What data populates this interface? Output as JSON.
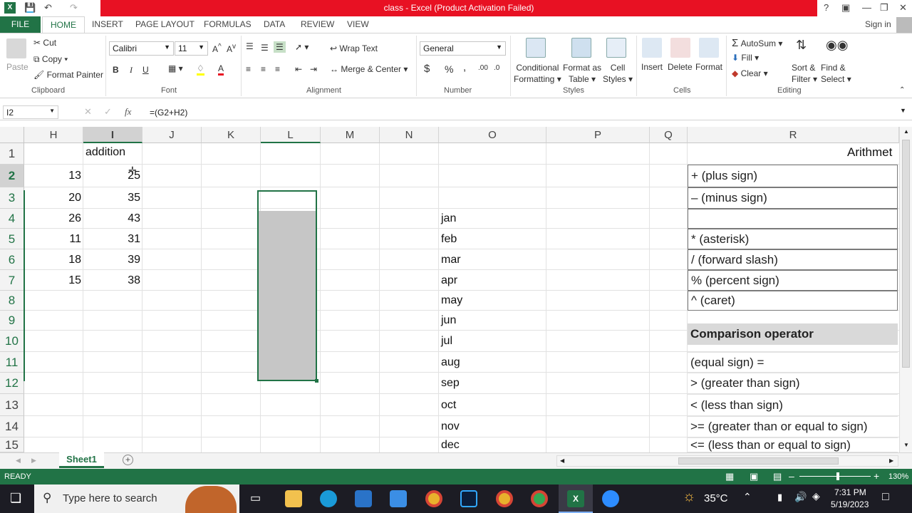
{
  "window": {
    "title": "class - Excel (Product Activation Failed)",
    "sign_in": "Sign in"
  },
  "tabs": [
    "FILE",
    "HOME",
    "INSERT",
    "PAGE LAYOUT",
    "FORMULAS",
    "DATA",
    "REVIEW",
    "VIEW"
  ],
  "ribbon": {
    "clipboard": {
      "paste": "Paste",
      "cut": "Cut",
      "copy": "Copy",
      "format_painter": "Format Painter",
      "label": "Clipboard"
    },
    "font": {
      "name": "Calibri",
      "size": "11",
      "label": "Font",
      "bold": "B",
      "italic": "I",
      "underline": "U"
    },
    "alignment": {
      "wrap": "Wrap Text",
      "merge": "Merge & Center",
      "label": "Alignment"
    },
    "number": {
      "format": "General",
      "currency": "$",
      "percent": "%",
      "comma": ",",
      "label": "Number"
    },
    "styles": {
      "conditional": "Conditional",
      "conditional2": "Formatting",
      "format_as": "Format as",
      "format_as2": "Table",
      "cell": "Cell",
      "cell2": "Styles",
      "label": "Styles"
    },
    "cells": {
      "insert": "Insert",
      "delete": "Delete",
      "format": "Format",
      "label": "Cells"
    },
    "editing": {
      "autosum": "AutoSum",
      "fill": "Fill",
      "clear": "Clear",
      "sort": "Sort &",
      "sort2": "Filter",
      "find": "Find &",
      "find2": "Select",
      "label": "Editing"
    }
  },
  "formula_bar": {
    "name_box": "I2",
    "formula": "=(G2+H2)",
    "fx": "fx"
  },
  "columns": [
    {
      "name": "H"
    },
    {
      "name": "I"
    },
    {
      "name": "J"
    },
    {
      "name": "K"
    },
    {
      "name": "L"
    },
    {
      "name": "M"
    },
    {
      "name": "N"
    },
    {
      "name": "O"
    },
    {
      "name": "P"
    },
    {
      "name": "Q"
    },
    {
      "name": "R"
    }
  ],
  "rows": [
    "1",
    "2",
    "3",
    "4",
    "5",
    "6",
    "7",
    "8",
    "9",
    "10",
    "11",
    "12",
    "13",
    "14",
    "15"
  ],
  "cells": {
    "I1": "addition",
    "H": [
      "13",
      "20",
      "26",
      "11",
      "18",
      "15"
    ],
    "I": [
      "25",
      "35",
      "43",
      "31",
      "39",
      "38"
    ],
    "O": [
      "jan",
      "feb",
      "mar",
      "apr",
      "may",
      "jun",
      "jul",
      "aug",
      "sep",
      "oct",
      "nov",
      "dec"
    ],
    "R1": "Arithmet",
    "R_arith": [
      "+ (plus sign)",
      "– (minus sign)",
      "",
      "* (asterisk)",
      "/ (forward slash)",
      "% (percent sign)",
      "^ (caret)"
    ],
    "R10": "Comparison operator",
    "R_comp": [
      " (equal sign) =",
      "> (greater than sign)",
      "< (less than sign)",
      ">= (greater than or equal to sign)",
      "<= (less than or equal to sign)"
    ]
  },
  "sheet_tab": "Sheet1",
  "status": {
    "ready": "READY",
    "zoom": "130%"
  },
  "taskbar": {
    "search": "Type here to search",
    "temp": "35°C",
    "time": "7:31 PM",
    "date": "5/19/2023"
  },
  "colors": {
    "excel_green": "#217346",
    "title_red": "#e81123"
  }
}
